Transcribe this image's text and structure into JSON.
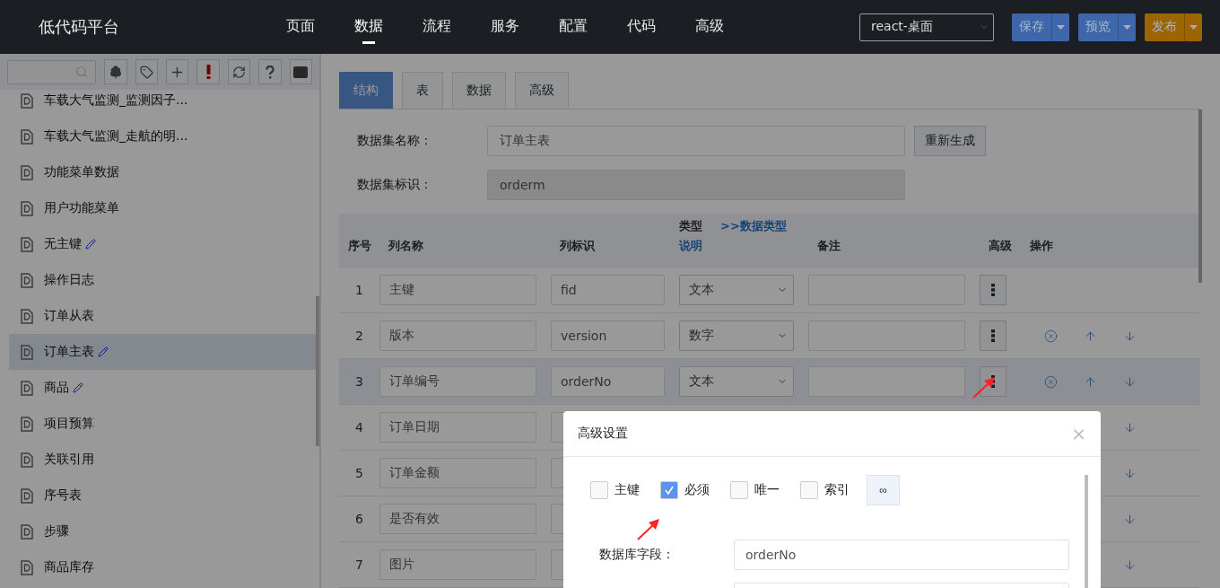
{
  "header": {
    "logo": "低代码平台",
    "nav": [
      {
        "label": "页面",
        "selected": false
      },
      {
        "label": "数据",
        "selected": true
      },
      {
        "label": "流程",
        "selected": false
      },
      {
        "label": "服务",
        "selected": false
      },
      {
        "label": "配置",
        "selected": false
      },
      {
        "label": "代码",
        "selected": false
      },
      {
        "label": "高级",
        "selected": false
      }
    ],
    "project_select": "react-桌面",
    "actions": [
      {
        "label": "保存",
        "kind": "primary"
      },
      {
        "label": "预览",
        "kind": "primary"
      },
      {
        "label": "发布",
        "kind": "warning"
      }
    ]
  },
  "sidebar": {
    "tools": [
      {
        "kind": "tree"
      },
      {
        "kind": "tag"
      },
      {
        "kind": "add"
      },
      {
        "kind": "alert"
      },
      {
        "kind": "refresh"
      },
      {
        "kind": "help"
      },
      {
        "kind": "chat"
      }
    ],
    "items": [
      {
        "label": "车载大气监测_监测因子...",
        "edited": false,
        "selected": false
      },
      {
        "label": "车载大气监测_走航的明...",
        "edited": false,
        "selected": false
      },
      {
        "label": "功能菜单数据",
        "edited": false,
        "selected": false
      },
      {
        "label": "用户功能菜单",
        "edited": false,
        "selected": false
      },
      {
        "label": "无主键",
        "edited": true,
        "selected": false
      },
      {
        "label": "操作日志",
        "edited": false,
        "selected": false
      },
      {
        "label": "订单从表",
        "edited": false,
        "selected": false
      },
      {
        "label": "订单主表",
        "edited": true,
        "selected": true
      },
      {
        "label": "商品",
        "edited": true,
        "selected": false
      },
      {
        "label": "项目预算",
        "edited": false,
        "selected": false
      },
      {
        "label": "关联引用",
        "edited": false,
        "selected": false
      },
      {
        "label": "序号表",
        "edited": false,
        "selected": false
      },
      {
        "label": "步骤",
        "edited": false,
        "selected": false
      },
      {
        "label": "商品库存",
        "edited": false,
        "selected": false
      }
    ]
  },
  "content": {
    "tabs": [
      {
        "label": "结构",
        "selected": true
      },
      {
        "label": "表",
        "selected": false
      },
      {
        "label": "数据",
        "selected": false
      },
      {
        "label": "高级",
        "selected": false
      }
    ],
    "form": [
      {
        "label": "数据集名称：",
        "value": "订单主表",
        "disabled": false,
        "button": "重新生成"
      },
      {
        "label": "数据集标识：",
        "value": "orderm",
        "disabled": true
      }
    ],
    "table": {
      "columns": [
        {
          "label": "序号"
        },
        {
          "label": "列名称"
        },
        {
          "label": "列标识"
        },
        {
          "label": "类型",
          "sub_label": "说明",
          "link": ">>数据类型"
        },
        {
          "label": "备注"
        },
        {
          "label": "高级"
        },
        {
          "label": "操作"
        }
      ],
      "rows": [
        {
          "index": "1",
          "name": "主键",
          "id": "fid",
          "type": "文本",
          "selected": false,
          "actions": []
        },
        {
          "index": "2",
          "name": "版本",
          "id": "version",
          "type": "数字",
          "selected": false,
          "actions": [
            {
              "kind": "delete"
            },
            {
              "kind": "up"
            },
            {
              "kind": "down"
            }
          ]
        },
        {
          "index": "3",
          "name": "订单编号",
          "id": "orderNo",
          "type": "文本",
          "selected": true,
          "actions": [
            {
              "kind": "delete"
            },
            {
              "kind": "up"
            },
            {
              "kind": "down"
            }
          ]
        },
        {
          "index": "4",
          "name": "订单日期",
          "selected": false,
          "actions": [
            {
              "kind": "down"
            }
          ]
        },
        {
          "index": "5",
          "name": "订单金额",
          "selected": false,
          "actions": [
            {
              "kind": "down"
            }
          ]
        },
        {
          "index": "6",
          "name": "是否有效",
          "selected": false,
          "actions": [
            {
              "kind": "down"
            }
          ]
        },
        {
          "index": "7",
          "name": "图片",
          "selected": false,
          "actions": [
            {
              "kind": "down"
            }
          ]
        }
      ]
    }
  },
  "modal": {
    "title": "高级设置",
    "close": "×",
    "options": [
      {
        "label": "主键",
        "checked": false
      },
      {
        "label": "必须",
        "checked": true
      },
      {
        "label": "唯一",
        "checked": false
      },
      {
        "label": "索引",
        "checked": false
      }
    ],
    "link_button": "∞",
    "fields": [
      {
        "kind": "text",
        "label": "数据库字段：",
        "value": "orderNo"
      },
      {
        "kind": "text"
      }
    ]
  }
}
